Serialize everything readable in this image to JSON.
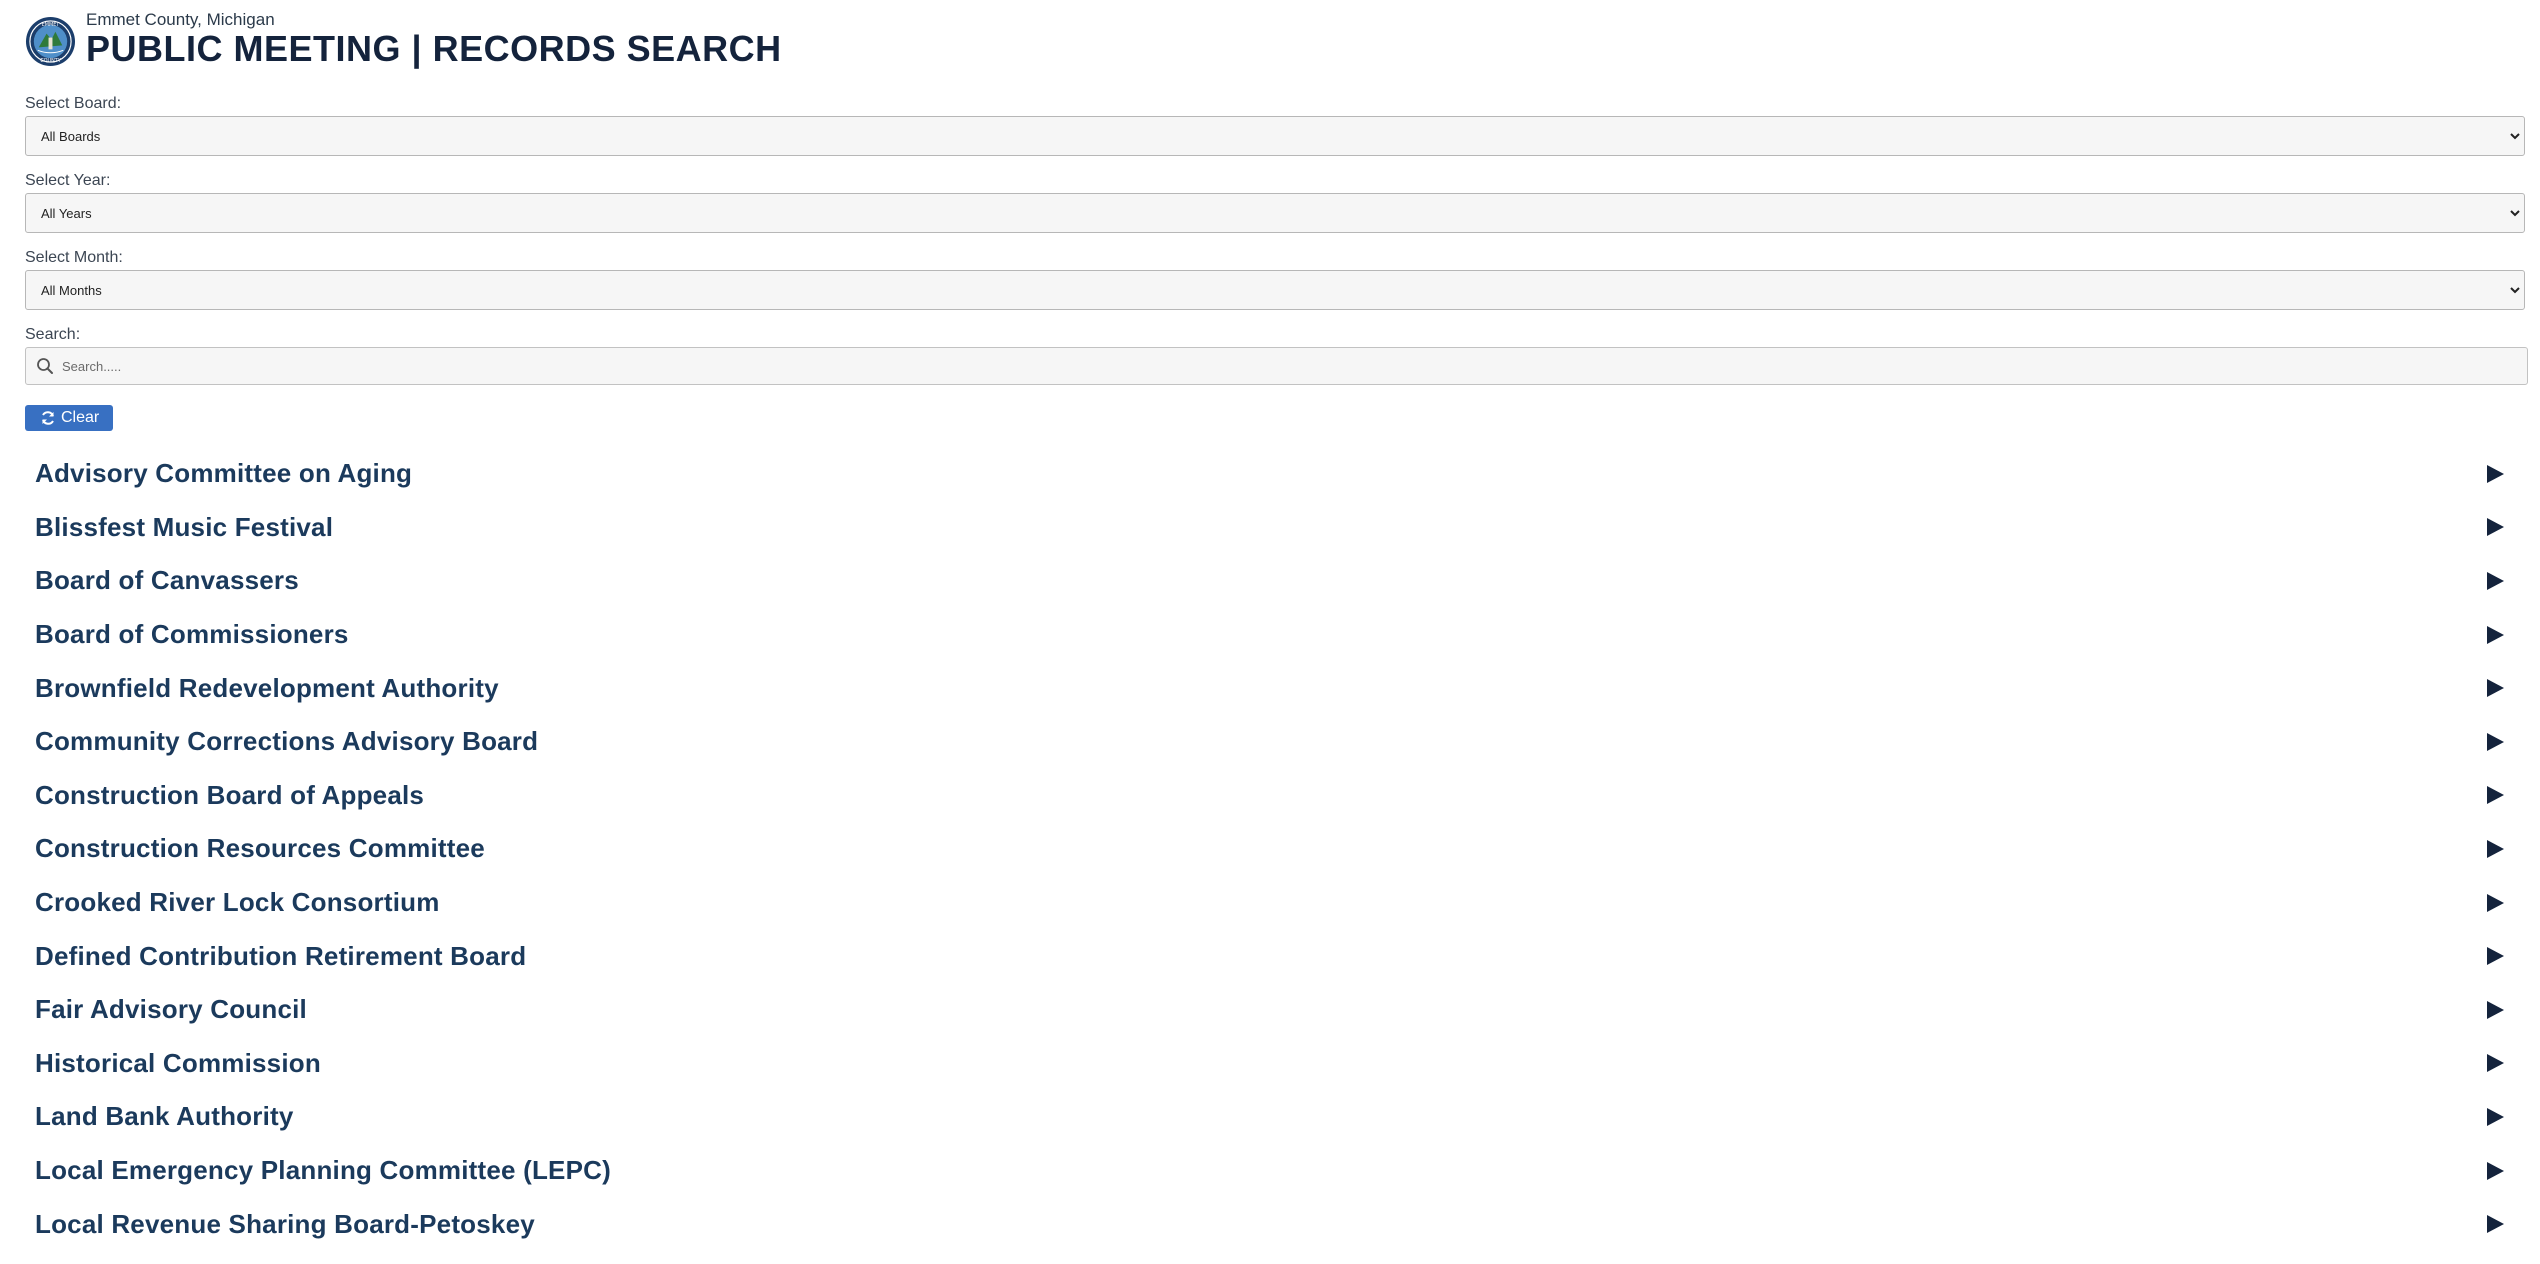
{
  "header": {
    "subtitle": "Emmet County, Michigan",
    "title": "PUBLIC MEETING | RECORDS SEARCH",
    "seal_icon": "county-seal-icon"
  },
  "filters": {
    "board": {
      "label": "Select Board:",
      "value": "All Boards"
    },
    "year": {
      "label": "Select Year:",
      "value": "All Years"
    },
    "month": {
      "label": "Select Month:",
      "value": "All Months"
    },
    "search": {
      "label": "Search:",
      "placeholder": "Search....."
    }
  },
  "clear_button": {
    "label": "Clear",
    "icon": "refresh-icon"
  },
  "boards": [
    "Advisory Committee on Aging",
    "Blissfest Music Festival",
    "Board of Canvassers",
    "Board of Commissioners",
    "Brownfield Redevelopment Authority",
    "Community Corrections Advisory Board",
    "Construction Board of Appeals",
    "Construction Resources Committee",
    "Crooked River Lock Consortium",
    "Defined Contribution Retirement Board",
    "Fair Advisory Council",
    "Historical Commission",
    "Land Bank Authority",
    "Local Emergency Planning Committee (LEPC)",
    "Local Revenue Sharing Board-Petoskey"
  ],
  "colors": {
    "title": "#14233c",
    "board_text": "#1b3a5c",
    "button_bg": "#3870c2",
    "input_bg": "#f6f6f6"
  }
}
